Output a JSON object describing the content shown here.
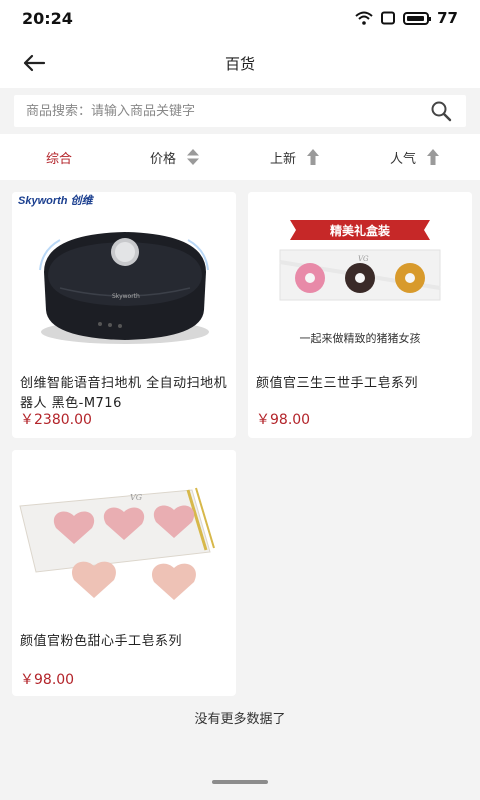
{
  "status_bar": {
    "time": "20:24",
    "battery": "77"
  },
  "nav": {
    "title": "百货"
  },
  "search": {
    "placeholder": "商品搜索：请输入商品关键字",
    "value": ""
  },
  "sort": {
    "comprehensive": "综合",
    "price": "价格",
    "new": "上新",
    "popular": "人气",
    "active": "comprehensive",
    "active_color": "#b3242a"
  },
  "products": [
    {
      "name": "创维智能语音扫地机 全自动扫地机器人 黑色-M716",
      "price": "￥2380.00",
      "brand_logo": "Skyworth 创维",
      "model_mark": "Skyworth"
    },
    {
      "name": "颜值官三生三世手工皂系列",
      "price": "￥98.00",
      "banner": "精美礼盒装",
      "caption": "一起来做精致的猪猪女孩",
      "logo": "VG"
    },
    {
      "name": "颜值官粉色甜心手工皂系列",
      "price": "￥98.00",
      "logo": "VG"
    }
  ],
  "footer": {
    "no_more": "没有更多数据了"
  },
  "colors": {
    "accent": "#b3242a",
    "background": "#f3f3f3"
  },
  "icons": [
    "wifi-icon",
    "screen-icon",
    "battery-icon",
    "back-arrow-icon",
    "search-icon",
    "sort-both-icon",
    "arrow-up-icon"
  ]
}
